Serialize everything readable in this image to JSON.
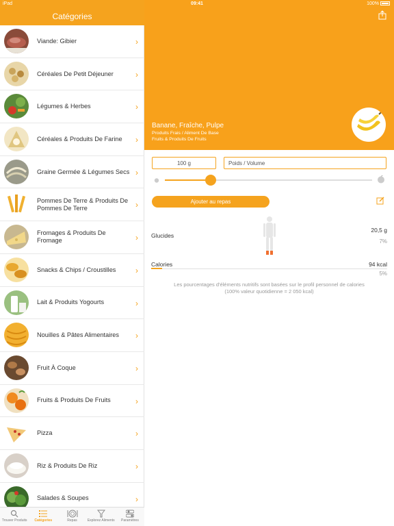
{
  "status": {
    "left": "iPad",
    "time": "09:41",
    "battery": "100%"
  },
  "sidebar": {
    "title": "Catégories",
    "items": [
      {
        "label": "Viande: Gibier"
      },
      {
        "label": "Céréales De Petit Déjeuner"
      },
      {
        "label": "Légumes & Herbes"
      },
      {
        "label": "Céréales & Produits De Farine"
      },
      {
        "label": "Graine Germée & Légumes Secs"
      },
      {
        "label": "Pommes De Terre & Produits De Pommes De Terre"
      },
      {
        "label": "Fromages & Produits De Fromage"
      },
      {
        "label": "Snacks & Chips / Croustilles"
      },
      {
        "label": "Lait & Produits Yogourts"
      },
      {
        "label": "Nouilles & Pâtes Alimentaires"
      },
      {
        "label": "Fruit À Coque"
      },
      {
        "label": "Fruits & Produits De Fruits"
      },
      {
        "label": "Pizza"
      },
      {
        "label": "Riz & Produits De Riz"
      },
      {
        "label": "Salades & Soupes"
      }
    ]
  },
  "tabbar": {
    "tabs": [
      {
        "label": "Trouver Produits"
      },
      {
        "label": "Catégories"
      },
      {
        "label": "Repas"
      },
      {
        "label": "Explorez Aliments"
      },
      {
        "label": "Paramètres"
      }
    ]
  },
  "detail": {
    "name": "Banane, Fraîche, Pulpe",
    "category": "Produits Frais / Aliment De Base",
    "subcategory": "Fruits & Produits De Fruits",
    "quantity": "100 g",
    "unit_placeholder": "Poids / Volume",
    "slider_level": 0.22,
    "add_button": "Ajouter au repas",
    "nutrients": [
      {
        "label": "Glucides",
        "value": "20,5 g",
        "percent": "7%"
      },
      {
        "label": "Calories",
        "value": "94 kcal",
        "percent": "5%"
      }
    ],
    "calorie_bar_level": 0.05,
    "note_line1": "Les pourcentages d'éléments nutritifs sont basées sur le profil personnel de calories",
    "note_line2": "(100% valeur quotidienne = 2 050 kcal)"
  },
  "colors": {
    "accent": "#f5a31e",
    "hero": "#f8a11b"
  }
}
